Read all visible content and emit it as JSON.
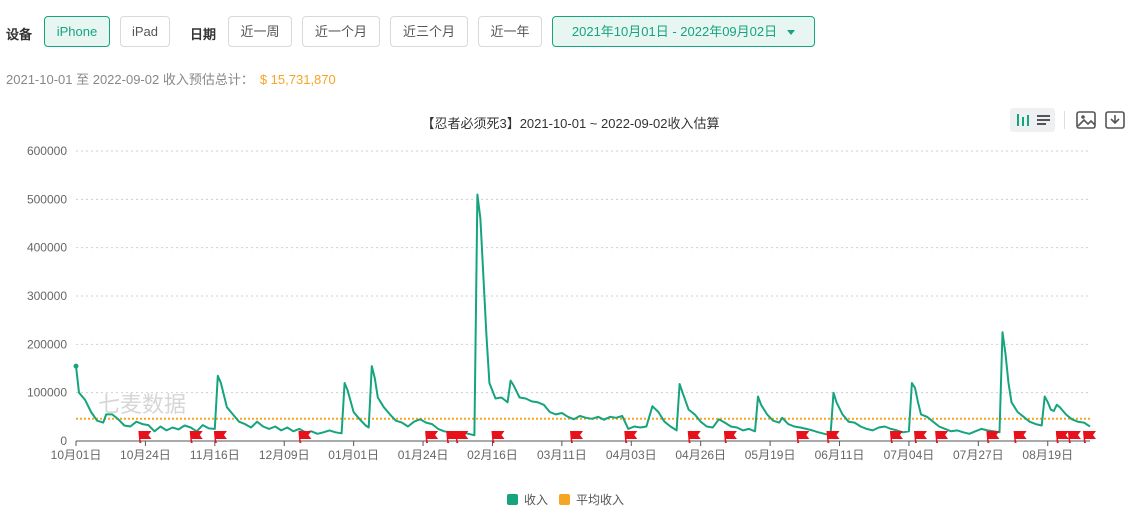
{
  "filters": {
    "device_label": "设备",
    "devices": [
      "iPhone",
      "iPad"
    ],
    "active_device": "iPhone",
    "date_label": "日期",
    "ranges": [
      "近一周",
      "近一个月",
      "近三个月",
      "近一年"
    ],
    "date_range": "2021年10月01日 - 2022年09月02日"
  },
  "summary": {
    "text": "2021-10-01 至 2022-09-02 收入预估总计：",
    "total": "$ 15,731,870"
  },
  "watermark": "七麦数据",
  "icons": [
    "bar-chart-icon",
    "list-icon",
    "image-icon",
    "download-icon"
  ],
  "colors": {
    "accent": "#16a47e",
    "line": "#16a47e",
    "average": "#f5a623",
    "flag": "#e8101a"
  },
  "chart_data": {
    "type": "line",
    "title": "【忍者必须死3】2021-10-01 ~ 2022-09-02收入估算",
    "x_start": "2021-10-01",
    "x_end": "2022-09-02",
    "xticks": [
      "10月01日",
      "10月24日",
      "11月16日",
      "12月09日",
      "01月01日",
      "01月24日",
      "02月16日",
      "03月11日",
      "04月03日",
      "04月26日",
      "05月19日",
      "06月11日",
      "07月04日",
      "07月27日",
      "08月19日"
    ],
    "ylim": [
      0,
      600000
    ],
    "yticks": [
      0,
      100000,
      200000,
      300000,
      400000,
      500000,
      600000
    ],
    "grid": true,
    "legend_position": "bottom",
    "series": [
      {
        "name": "收入",
        "color": "#16a47e",
        "points": [
          [
            "2021-10-01",
            155000
          ],
          [
            "2021-10-02",
            100000
          ],
          [
            "2021-10-04",
            85000
          ],
          [
            "2021-10-06",
            60000
          ],
          [
            "2021-10-08",
            42000
          ],
          [
            "2021-10-10",
            38000
          ],
          [
            "2021-10-11",
            55000
          ],
          [
            "2021-10-13",
            55000
          ],
          [
            "2021-10-15",
            45000
          ],
          [
            "2021-10-17",
            32000
          ],
          [
            "2021-10-19",
            30000
          ],
          [
            "2021-10-21",
            40000
          ],
          [
            "2021-10-23",
            35000
          ],
          [
            "2021-10-25",
            33000
          ],
          [
            "2021-10-27",
            20000
          ],
          [
            "2021-10-29",
            30000
          ],
          [
            "2021-10-31",
            22000
          ],
          [
            "2021-11-02",
            28000
          ],
          [
            "2021-11-04",
            24000
          ],
          [
            "2021-11-06",
            32000
          ],
          [
            "2021-11-08",
            28000
          ],
          [
            "2021-11-10",
            20000
          ],
          [
            "2021-11-12",
            33000
          ],
          [
            "2021-11-14",
            26000
          ],
          [
            "2021-11-16",
            25000
          ],
          [
            "2021-11-17",
            135000
          ],
          [
            "2021-11-18",
            120000
          ],
          [
            "2021-11-20",
            70000
          ],
          [
            "2021-11-22",
            55000
          ],
          [
            "2021-11-24",
            40000
          ],
          [
            "2021-11-26",
            35000
          ],
          [
            "2021-11-28",
            28000
          ],
          [
            "2021-11-30",
            40000
          ],
          [
            "2021-12-02",
            30000
          ],
          [
            "2021-12-04",
            25000
          ],
          [
            "2021-12-06",
            30000
          ],
          [
            "2021-12-08",
            22000
          ],
          [
            "2021-12-10",
            28000
          ],
          [
            "2021-12-12",
            20000
          ],
          [
            "2021-12-14",
            25000
          ],
          [
            "2021-12-16",
            18000
          ],
          [
            "2021-12-18",
            20000
          ],
          [
            "2021-12-20",
            15000
          ],
          [
            "2021-12-22",
            18000
          ],
          [
            "2021-12-24",
            22000
          ],
          [
            "2021-12-26",
            18000
          ],
          [
            "2021-12-28",
            16000
          ],
          [
            "2021-12-29",
            120000
          ],
          [
            "2021-12-30",
            105000
          ],
          [
            "2022-01-01",
            60000
          ],
          [
            "2022-01-03",
            45000
          ],
          [
            "2022-01-05",
            32000
          ],
          [
            "2022-01-06",
            28000
          ],
          [
            "2022-01-07",
            155000
          ],
          [
            "2022-01-08",
            130000
          ],
          [
            "2022-01-09",
            90000
          ],
          [
            "2022-01-11",
            70000
          ],
          [
            "2022-01-13",
            55000
          ],
          [
            "2022-01-15",
            42000
          ],
          [
            "2022-01-17",
            38000
          ],
          [
            "2022-01-19",
            30000
          ],
          [
            "2022-01-21",
            40000
          ],
          [
            "2022-01-23",
            45000
          ],
          [
            "2022-01-25",
            38000
          ],
          [
            "2022-01-27",
            35000
          ],
          [
            "2022-01-29",
            25000
          ],
          [
            "2022-01-31",
            20000
          ],
          [
            "2022-02-02",
            18000
          ],
          [
            "2022-02-04",
            15000
          ],
          [
            "2022-02-06",
            18000
          ],
          [
            "2022-02-08",
            15000
          ],
          [
            "2022-02-10",
            12000
          ],
          [
            "2022-02-11",
            510000
          ],
          [
            "2022-02-12",
            460000
          ],
          [
            "2022-02-14",
            220000
          ],
          [
            "2022-02-15",
            120000
          ],
          [
            "2022-02-17",
            88000
          ],
          [
            "2022-02-19",
            90000
          ],
          [
            "2022-02-21",
            80000
          ],
          [
            "2022-02-22",
            125000
          ],
          [
            "2022-02-23",
            115000
          ],
          [
            "2022-02-25",
            90000
          ],
          [
            "2022-02-27",
            88000
          ],
          [
            "2022-03-01",
            82000
          ],
          [
            "2022-03-03",
            80000
          ],
          [
            "2022-03-05",
            75000
          ],
          [
            "2022-03-07",
            60000
          ],
          [
            "2022-03-09",
            55000
          ],
          [
            "2022-03-11",
            58000
          ],
          [
            "2022-03-13",
            50000
          ],
          [
            "2022-03-15",
            45000
          ],
          [
            "2022-03-17",
            52000
          ],
          [
            "2022-03-19",
            48000
          ],
          [
            "2022-03-21",
            46000
          ],
          [
            "2022-03-23",
            50000
          ],
          [
            "2022-03-25",
            44000
          ],
          [
            "2022-03-27",
            50000
          ],
          [
            "2022-03-29",
            48000
          ],
          [
            "2022-03-31",
            52000
          ],
          [
            "2022-04-02",
            25000
          ],
          [
            "2022-04-04",
            30000
          ],
          [
            "2022-04-06",
            28000
          ],
          [
            "2022-04-08",
            30000
          ],
          [
            "2022-04-10",
            72000
          ],
          [
            "2022-04-12",
            60000
          ],
          [
            "2022-04-14",
            40000
          ],
          [
            "2022-04-16",
            30000
          ],
          [
            "2022-04-18",
            22000
          ],
          [
            "2022-04-19",
            118000
          ],
          [
            "2022-04-20",
            100000
          ],
          [
            "2022-04-22",
            65000
          ],
          [
            "2022-04-24",
            55000
          ],
          [
            "2022-04-26",
            40000
          ],
          [
            "2022-04-28",
            30000
          ],
          [
            "2022-04-30",
            28000
          ],
          [
            "2022-05-02",
            45000
          ],
          [
            "2022-05-04",
            38000
          ],
          [
            "2022-05-06",
            30000
          ],
          [
            "2022-05-08",
            28000
          ],
          [
            "2022-05-10",
            22000
          ],
          [
            "2022-05-12",
            25000
          ],
          [
            "2022-05-14",
            20000
          ],
          [
            "2022-05-15",
            92000
          ],
          [
            "2022-05-16",
            75000
          ],
          [
            "2022-05-18",
            55000
          ],
          [
            "2022-05-20",
            42000
          ],
          [
            "2022-05-22",
            38000
          ],
          [
            "2022-05-23",
            48000
          ],
          [
            "2022-05-25",
            35000
          ],
          [
            "2022-05-27",
            30000
          ],
          [
            "2022-05-29",
            28000
          ],
          [
            "2022-05-31",
            25000
          ],
          [
            "2022-06-02",
            22000
          ],
          [
            "2022-06-04",
            18000
          ],
          [
            "2022-06-06",
            15000
          ],
          [
            "2022-06-08",
            12000
          ],
          [
            "2022-06-09",
            100000
          ],
          [
            "2022-06-10",
            80000
          ],
          [
            "2022-06-12",
            55000
          ],
          [
            "2022-06-14",
            40000
          ],
          [
            "2022-06-16",
            38000
          ],
          [
            "2022-06-18",
            30000
          ],
          [
            "2022-06-20",
            25000
          ],
          [
            "2022-06-22",
            22000
          ],
          [
            "2022-06-24",
            28000
          ],
          [
            "2022-06-26",
            30000
          ],
          [
            "2022-06-28",
            25000
          ],
          [
            "2022-06-30",
            22000
          ],
          [
            "2022-07-02",
            18000
          ],
          [
            "2022-07-04",
            20000
          ],
          [
            "2022-07-05",
            120000
          ],
          [
            "2022-07-06",
            110000
          ],
          [
            "2022-07-07",
            80000
          ],
          [
            "2022-07-08",
            55000
          ],
          [
            "2022-07-10",
            50000
          ],
          [
            "2022-07-12",
            40000
          ],
          [
            "2022-07-14",
            30000
          ],
          [
            "2022-07-16",
            25000
          ],
          [
            "2022-07-18",
            20000
          ],
          [
            "2022-07-20",
            22000
          ],
          [
            "2022-07-22",
            18000
          ],
          [
            "2022-07-24",
            15000
          ],
          [
            "2022-07-26",
            20000
          ],
          [
            "2022-07-28",
            25000
          ],
          [
            "2022-07-30",
            22000
          ],
          [
            "2022-08-01",
            20000
          ],
          [
            "2022-08-03",
            18000
          ],
          [
            "2022-08-04",
            225000
          ],
          [
            "2022-08-05",
            180000
          ],
          [
            "2022-08-06",
            120000
          ],
          [
            "2022-08-07",
            80000
          ],
          [
            "2022-08-09",
            60000
          ],
          [
            "2022-08-11",
            50000
          ],
          [
            "2022-08-13",
            40000
          ],
          [
            "2022-08-15",
            35000
          ],
          [
            "2022-08-17",
            32000
          ],
          [
            "2022-08-18",
            92000
          ],
          [
            "2022-08-19",
            80000
          ],
          [
            "2022-08-20",
            65000
          ],
          [
            "2022-08-21",
            62000
          ],
          [
            "2022-08-22",
            75000
          ],
          [
            "2022-08-23",
            70000
          ],
          [
            "2022-08-25",
            55000
          ],
          [
            "2022-08-27",
            45000
          ],
          [
            "2022-08-29",
            40000
          ],
          [
            "2022-08-31",
            38000
          ],
          [
            "2022-09-02",
            30000
          ]
        ]
      },
      {
        "name": "平均收入",
        "color": "#f5a623",
        "style": "dotted",
        "value": 46000
      }
    ],
    "flag_markers": [
      "2021-10-24",
      "2021-11-10",
      "2021-11-18",
      "2021-12-16",
      "2022-01-27",
      "2022-02-03",
      "2022-02-06",
      "2022-02-18",
      "2022-03-16",
      "2022-04-03",
      "2022-04-24",
      "2022-05-06",
      "2022-05-30",
      "2022-06-09",
      "2022-06-30",
      "2022-07-08",
      "2022-07-15",
      "2022-08-01",
      "2022-08-10",
      "2022-08-24",
      "2022-08-28",
      "2022-09-02"
    ]
  }
}
